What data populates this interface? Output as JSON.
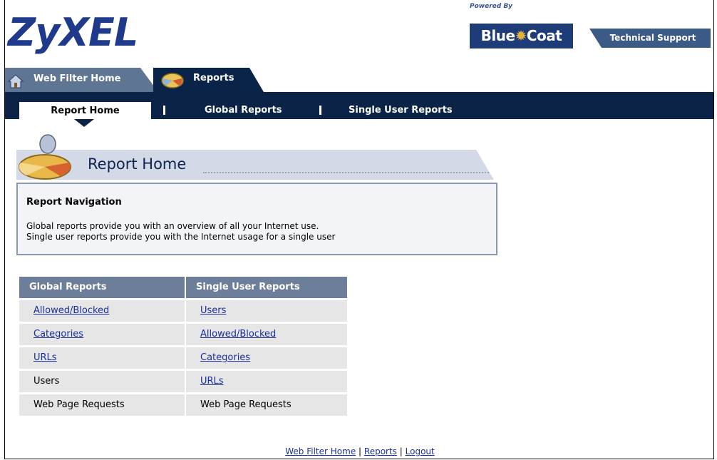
{
  "header": {
    "logo": "ZyXEL",
    "powered_by": "Powered By",
    "partner_logo": "BlueCoat",
    "partner_part1": "Blue",
    "partner_part2": "Coat",
    "tech_support": "Technical Support"
  },
  "tabs": [
    {
      "label": "Web Filter Home",
      "icon": "home-icon"
    },
    {
      "label": "Reports",
      "icon": "reports-pie-icon"
    }
  ],
  "subnav": {
    "active": "Report Home",
    "items": [
      "Global Reports",
      "Single User Reports"
    ]
  },
  "page": {
    "title": "Report Home"
  },
  "navigation": {
    "heading": "Report Navigation",
    "line1": "Global reports provide you with an overview of all your Internet use.",
    "line2": "Single user reports provide you with the Internet usage for a single user"
  },
  "global_reports": {
    "heading": "Global Reports",
    "items": [
      {
        "label": "Allowed/Blocked",
        "link": true
      },
      {
        "label": "Categories",
        "link": true
      },
      {
        "label": "URLs",
        "link": true
      },
      {
        "label": "Users",
        "link": false
      },
      {
        "label": "Web Page Requests",
        "link": false
      }
    ]
  },
  "single_user_reports": {
    "heading": "Single User Reports",
    "items": [
      {
        "label": "Users",
        "link": true
      },
      {
        "label": "Allowed/Blocked",
        "link": true
      },
      {
        "label": "Categories",
        "link": true
      },
      {
        "label": "URLs",
        "link": true
      },
      {
        "label": "Web Page Requests",
        "link": false
      }
    ]
  },
  "footer": {
    "links": [
      "Web Filter Home",
      "Reports",
      "Logout"
    ],
    "separator": "|"
  },
  "colors": {
    "navy": "#0b2346",
    "slate": "#5e7594",
    "link": "#1a2f9c"
  }
}
